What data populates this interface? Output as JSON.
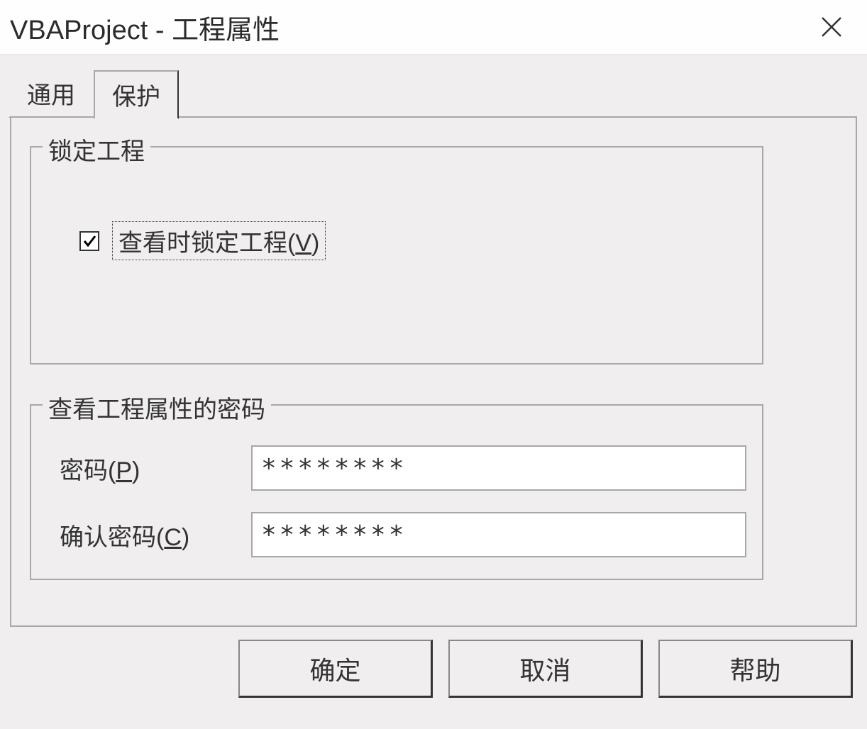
{
  "window": {
    "title": "VBAProject - 工程属性"
  },
  "tabs": {
    "general": "通用",
    "protection": "保护"
  },
  "lockGroup": {
    "title": "锁定工程",
    "checkboxLabelPrefix": "查看时锁定工程(",
    "checkboxLabelHotkey": "V",
    "checkboxLabelSuffix": ")",
    "checked": true
  },
  "passwordGroup": {
    "title": "查看工程属性的密码",
    "passwordLabelPrefix": "密码(",
    "passwordLabelHotkey": "P",
    "passwordLabelSuffix": ")",
    "confirmLabelPrefix": "确认密码(",
    "confirmLabelHotkey": "C",
    "confirmLabelSuffix": ")",
    "passwordValue": "********",
    "confirmValue": "********"
  },
  "buttons": {
    "ok": "确定",
    "cancel": "取消",
    "help": "帮助"
  }
}
